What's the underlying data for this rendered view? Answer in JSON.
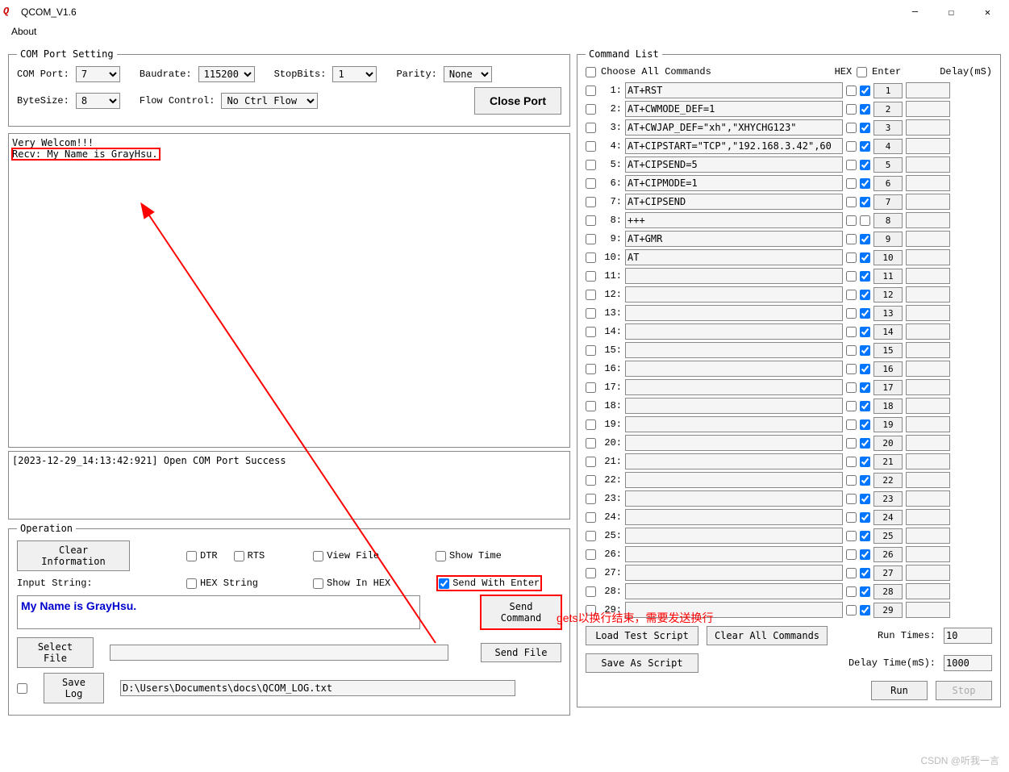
{
  "window": {
    "title": "QCOM_V1.6",
    "menu_about": "About"
  },
  "com_port_setting": {
    "legend": "COM Port Setting",
    "com_port_label": "COM Port:",
    "com_port_value": "7",
    "baudrate_label": "Baudrate:",
    "baudrate_value": "115200",
    "stopbits_label": "StopBits:",
    "stopbits_value": "1",
    "parity_label": "Parity:",
    "parity_value": "None",
    "bytesize_label": "ByteSize:",
    "bytesize_value": "8",
    "flow_label": "Flow Control:",
    "flow_value": "No Ctrl Flow",
    "close_port_btn": "Close Port"
  },
  "terminal": {
    "line1": "Very Welcom!!!",
    "line2": "Recv: My Name is GrayHsu.",
    "status_line": "[2023-12-29_14:13:42:921] Open COM Port Success"
  },
  "operation": {
    "legend": "Operation",
    "clear_info_btn": "Clear Information",
    "dtr_label": "DTR",
    "rts_label": "RTS",
    "view_file_label": "View File",
    "show_time_label": "Show Time",
    "hex_string_label": "HEX String",
    "show_in_hex_label": "Show In HEX",
    "send_with_enter_label": "Send With Enter",
    "input_string_label": "Input String:",
    "input_string_value": "My Name is GrayHsu.",
    "send_command_btn": "Send Command",
    "select_file_btn": "Select File",
    "send_file_btn": "Send File",
    "save_log_label": "Save Log",
    "log_path": "D:\\Users\\Documents\\docs\\QCOM_LOG.txt"
  },
  "command_list": {
    "legend": "Command List",
    "choose_all_label": "Choose All Commands",
    "hex_label": "HEX",
    "enter_label": "Enter",
    "delay_label": "Delay(mS)",
    "rows": [
      {
        "idx": "1:",
        "cmd": "AT+RST",
        "hex": false,
        "enter": true,
        "btn": "1",
        "delay": ""
      },
      {
        "idx": "2:",
        "cmd": "AT+CWMODE_DEF=1",
        "hex": false,
        "enter": true,
        "btn": "2",
        "delay": ""
      },
      {
        "idx": "3:",
        "cmd": "AT+CWJAP_DEF=\"xh\",\"XHYCHG123\"",
        "hex": false,
        "enter": true,
        "btn": "3",
        "delay": ""
      },
      {
        "idx": "4:",
        "cmd": "AT+CIPSTART=\"TCP\",\"192.168.3.42\",60",
        "hex": false,
        "enter": true,
        "btn": "4",
        "delay": ""
      },
      {
        "idx": "5:",
        "cmd": "AT+CIPSEND=5",
        "hex": false,
        "enter": true,
        "btn": "5",
        "delay": ""
      },
      {
        "idx": "6:",
        "cmd": "AT+CIPMODE=1",
        "hex": false,
        "enter": true,
        "btn": "6",
        "delay": ""
      },
      {
        "idx": "7:",
        "cmd": "AT+CIPSEND",
        "hex": false,
        "enter": true,
        "btn": "7",
        "delay": ""
      },
      {
        "idx": "8:",
        "cmd": "+++",
        "hex": false,
        "enter": false,
        "btn": "8",
        "delay": ""
      },
      {
        "idx": "9:",
        "cmd": "AT+GMR",
        "hex": false,
        "enter": true,
        "btn": "9",
        "delay": ""
      },
      {
        "idx": "10:",
        "cmd": "AT",
        "hex": false,
        "enter": true,
        "btn": "10",
        "delay": ""
      },
      {
        "idx": "11:",
        "cmd": "",
        "hex": false,
        "enter": true,
        "btn": "11",
        "delay": ""
      },
      {
        "idx": "12:",
        "cmd": "",
        "hex": false,
        "enter": true,
        "btn": "12",
        "delay": ""
      },
      {
        "idx": "13:",
        "cmd": "",
        "hex": false,
        "enter": true,
        "btn": "13",
        "delay": ""
      },
      {
        "idx": "14:",
        "cmd": "",
        "hex": false,
        "enter": true,
        "btn": "14",
        "delay": ""
      },
      {
        "idx": "15:",
        "cmd": "",
        "hex": false,
        "enter": true,
        "btn": "15",
        "delay": ""
      },
      {
        "idx": "16:",
        "cmd": "",
        "hex": false,
        "enter": true,
        "btn": "16",
        "delay": ""
      },
      {
        "idx": "17:",
        "cmd": "",
        "hex": false,
        "enter": true,
        "btn": "17",
        "delay": ""
      },
      {
        "idx": "18:",
        "cmd": "",
        "hex": false,
        "enter": true,
        "btn": "18",
        "delay": ""
      },
      {
        "idx": "19:",
        "cmd": "",
        "hex": false,
        "enter": true,
        "btn": "19",
        "delay": ""
      },
      {
        "idx": "20:",
        "cmd": "",
        "hex": false,
        "enter": true,
        "btn": "20",
        "delay": ""
      },
      {
        "idx": "21:",
        "cmd": "",
        "hex": false,
        "enter": true,
        "btn": "21",
        "delay": ""
      },
      {
        "idx": "22:",
        "cmd": "",
        "hex": false,
        "enter": true,
        "btn": "22",
        "delay": ""
      },
      {
        "idx": "23:",
        "cmd": "",
        "hex": false,
        "enter": true,
        "btn": "23",
        "delay": ""
      },
      {
        "idx": "24:",
        "cmd": "",
        "hex": false,
        "enter": true,
        "btn": "24",
        "delay": ""
      },
      {
        "idx": "25:",
        "cmd": "",
        "hex": false,
        "enter": true,
        "btn": "25",
        "delay": ""
      },
      {
        "idx": "26:",
        "cmd": "",
        "hex": false,
        "enter": true,
        "btn": "26",
        "delay": ""
      },
      {
        "idx": "27:",
        "cmd": "",
        "hex": false,
        "enter": true,
        "btn": "27",
        "delay": ""
      },
      {
        "idx": "28:",
        "cmd": "",
        "hex": false,
        "enter": true,
        "btn": "28",
        "delay": ""
      },
      {
        "idx": "29:",
        "cmd": "",
        "hex": false,
        "enter": true,
        "btn": "29",
        "delay": ""
      }
    ],
    "load_test_script_btn": "Load Test Script",
    "clear_all_btn": "Clear All Commands",
    "run_times_label": "Run Times:",
    "run_times_value": "10",
    "save_as_script_btn": "Save As Script",
    "delay_time_label": "Delay Time(mS):",
    "delay_time_value": "1000",
    "run_btn": "Run",
    "stop_btn": "Stop"
  },
  "annotation": {
    "text": "gets以换行结束，需要发送换行"
  },
  "watermark": "CSDN @听我一言"
}
